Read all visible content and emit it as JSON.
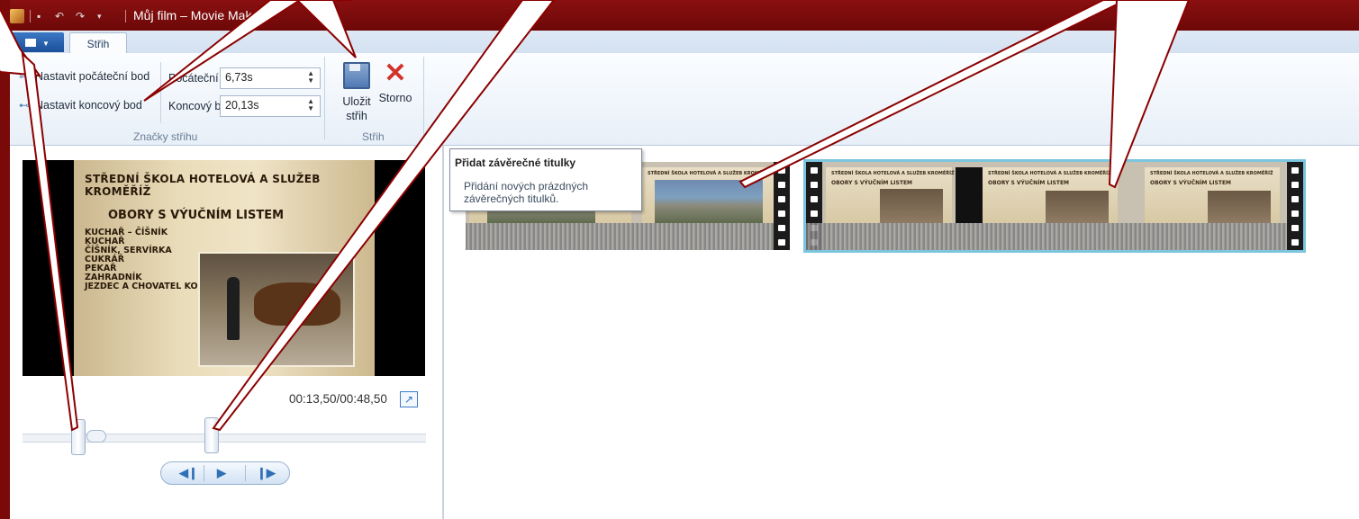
{
  "window": {
    "title": "Můj film – Movie Maker"
  },
  "ribbon": {
    "tab_label": "Střih",
    "set_start_label": "Nastavit počáteční bod",
    "set_end_label": "Nastavit koncový bod",
    "start_point_label": "Počáteční bod:",
    "start_point_value": "6,73s",
    "end_point_label": "Koncový bod:",
    "end_point_value": "20,13s",
    "group_marks_label": "Značky střihu",
    "save_label_1": "Uložit",
    "save_label_2": "střih",
    "cancel_label": "Storno",
    "group_trim_label": "Střih"
  },
  "preview": {
    "slide_title": "STŘEDNÍ ŠKOLA HOTELOVÁ A SLUŽEB KROMĚŘÍŽ",
    "slide_subtitle": "OBORY S VÝUČNÍM LISTEM",
    "slide_list": [
      "KUCHAŘ – ČÍŠNÍK",
      "KUCHAŘ",
      "ČÍŠNÍK, SERVÍRKA",
      "CUKRÁŘ",
      "PEKAŘ",
      "ZAHRADNÍK",
      "JEZDEC A CHOVATEL KONÍ"
    ],
    "time_display": "00:13,50/00:48,50"
  },
  "storyboard": {
    "thumb_caption": "STŘEDNÍ ŠKOLA HOTELOVÁ A SLUŽEB KROMĚŘÍŽ",
    "thumb_subtitle": "OBORY S VÝUČNÍM LISTEM"
  },
  "tooltip": {
    "title": "Přidat závěrečné titulky",
    "body": "Přidání nových prázdných závěrečných titulků."
  },
  "colors": {
    "window_border": "#7a0a0a",
    "selection_outline": "#7cc5de",
    "accent_blue": "#2d6fc0",
    "callout_stroke": "#8b0000"
  }
}
